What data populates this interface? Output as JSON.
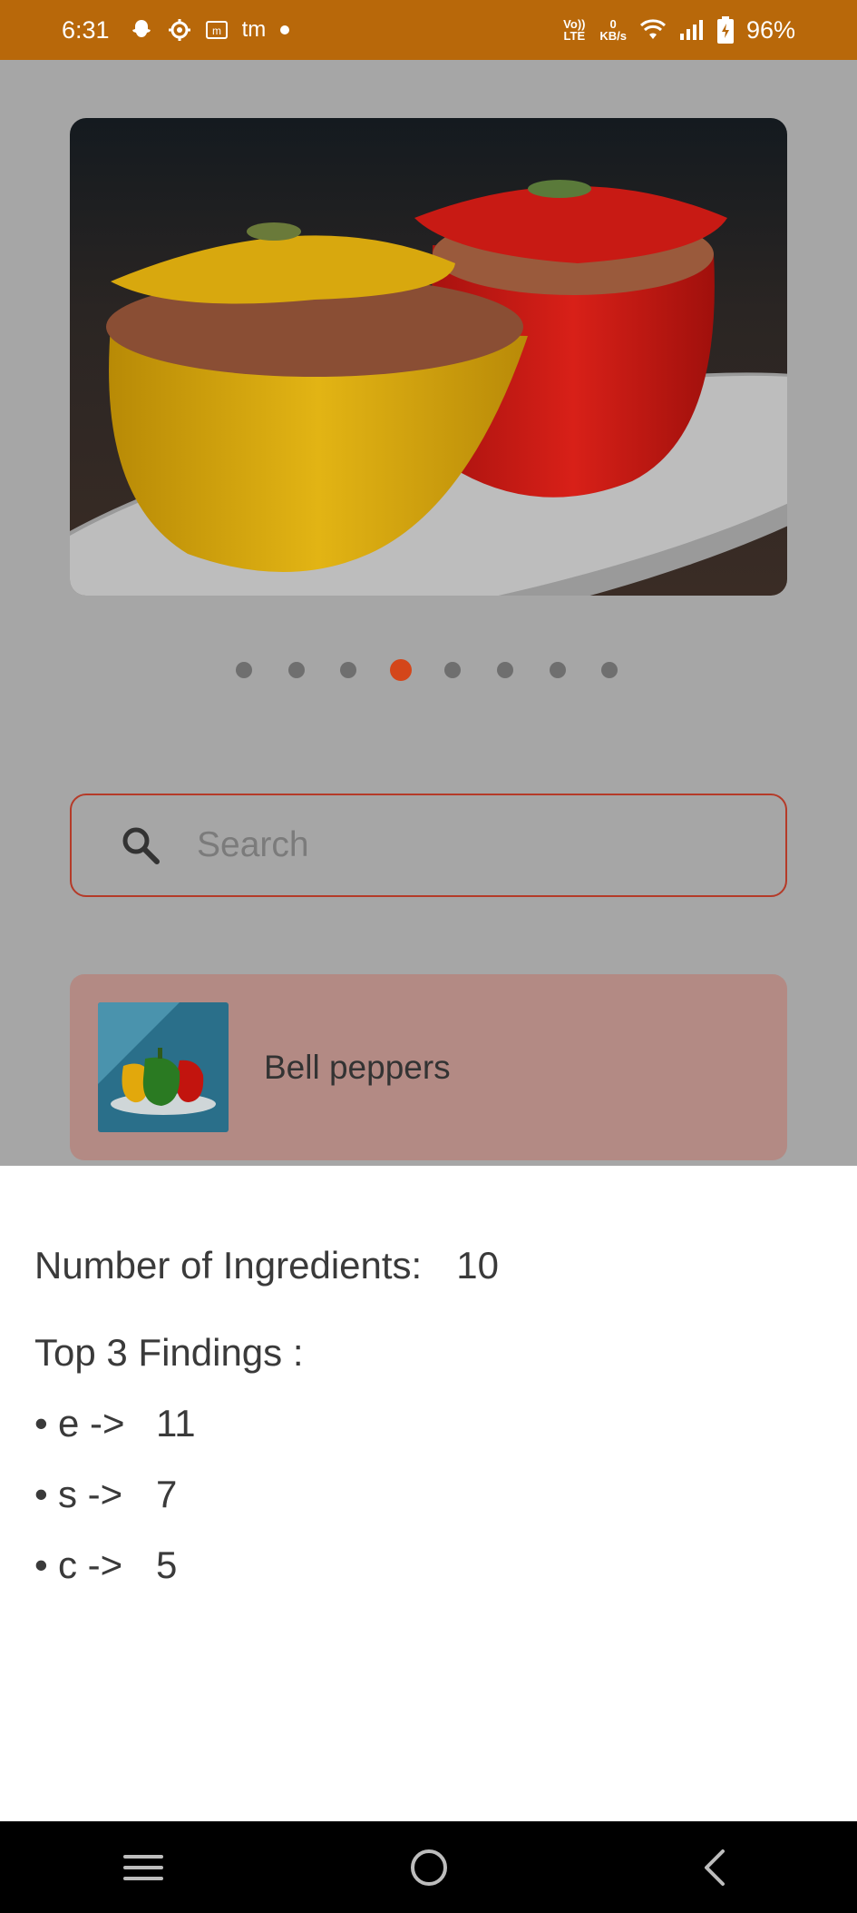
{
  "status_bar": {
    "time": "6:31",
    "volte": "Vo)) LTE",
    "net_speed_value": "0",
    "net_speed_unit": "KB/s",
    "battery": "96%",
    "icons": [
      "snapchat-icon",
      "settings-icon",
      "m-app-icon",
      "tm-app-icon",
      "dot-icon",
      "volte-icon",
      "wifi-icon",
      "signal-icon",
      "battery-icon"
    ],
    "tm_label": "tm"
  },
  "carousel": {
    "image": "stuffed-peppers-image",
    "dots_total": 8,
    "active_index": 3
  },
  "search": {
    "placeholder": "Search"
  },
  "result": {
    "label": "Bell peppers",
    "thumbnail": "bell-peppers-thumbnail"
  },
  "sheet": {
    "ingredients_label": "Number of Ingredients:",
    "ingredients_value": "10",
    "findings_title": "Top 3 Findings :",
    "findings": [
      {
        "bullet": "•",
        "key": "e ->",
        "value": "11"
      },
      {
        "bullet": "•",
        "key": "s ->",
        "value": "7"
      },
      {
        "bullet": "•",
        "key": "c ->",
        "value": "5"
      }
    ]
  },
  "nav": {
    "buttons": [
      "menu-icon",
      "home-icon",
      "back-icon"
    ]
  },
  "colors": {
    "status_bar": "#b8680a",
    "accent": "#d4461a",
    "card": "#b38a84",
    "dim_background": "#a6a6a6"
  }
}
